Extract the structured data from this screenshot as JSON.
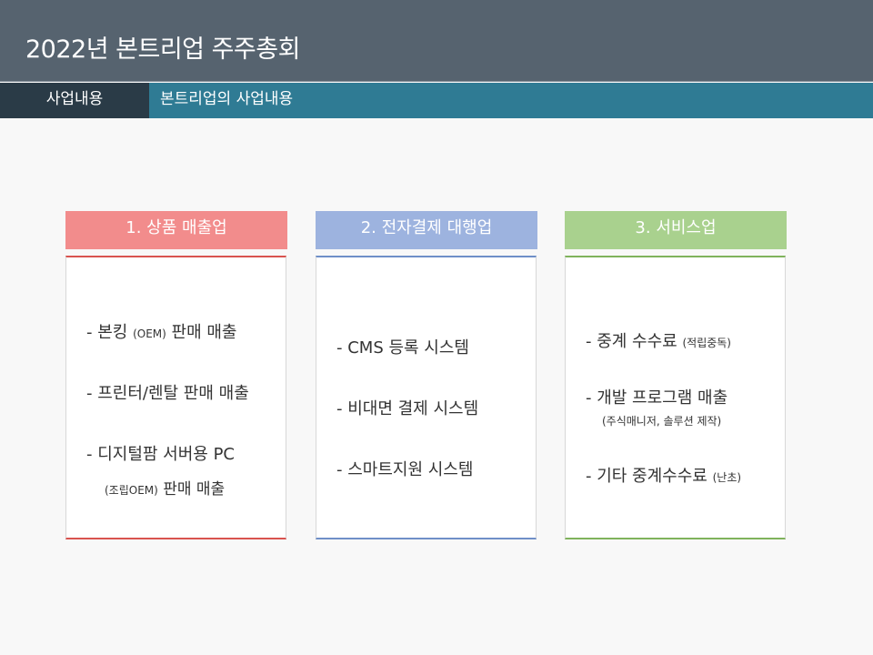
{
  "header": {
    "title": "2022년 본트리업 주주총회"
  },
  "subbar": {
    "section_label": "사업내용",
    "section_title": "본트리업의 사업내용"
  },
  "colors": {
    "card1": "#f28c8c",
    "card2": "#9db3df",
    "card3": "#a9d18e",
    "card1_line": "#d9534f",
    "card2_line": "#6f8fc8",
    "card3_line": "#7fb35c"
  },
  "cards": [
    {
      "heading": "1.  상품 매출업",
      "items": [
        {
          "text": "- 본킹 ",
          "small": "(OEM)",
          "text2": " 판매 매출"
        },
        {
          "text": "- 프린터/렌탈 판매 매출"
        },
        {
          "text": "- 디지털팜 서버용 PC",
          "sub": "(조립OEM)",
          "sub2": " 판매 매출"
        }
      ]
    },
    {
      "heading": "2.  전자결제 대행업",
      "items": [
        {
          "text": "- CMS 등록 시스템"
        },
        {
          "text": "- 비대면 결제 시스템"
        },
        {
          "text": "- 스마트지원 시스템"
        }
      ]
    },
    {
      "heading": "3.  서비스업",
      "items": [
        {
          "text": "- 중계 수수료 ",
          "small": "(적립중독)"
        },
        {
          "text": "- 개발 프로그램 매출",
          "sub": "(주식매니저, 솔루션 제작)"
        },
        {
          "text": "- 기타 중계수수료 ",
          "small": "(난초)"
        }
      ]
    }
  ]
}
